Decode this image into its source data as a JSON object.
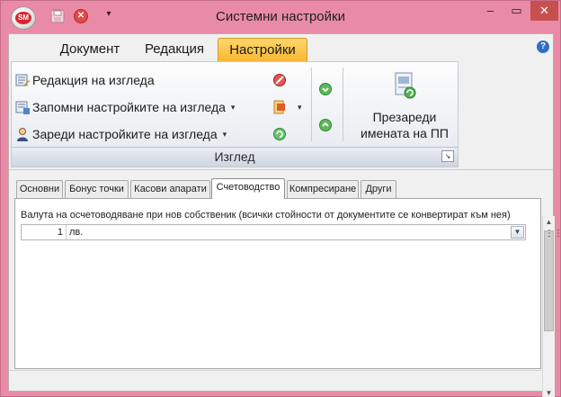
{
  "window": {
    "title": "Системни настройки",
    "app_badge": "SM",
    "minimize": "–",
    "maximize": "▭",
    "close": "✕",
    "quick_access_dropdown": "▾"
  },
  "ribbon": {
    "tabs": [
      {
        "label": "Документ",
        "active": false
      },
      {
        "label": "Редакция",
        "active": false
      },
      {
        "label": "Настройки",
        "active": true
      }
    ],
    "help": "?",
    "group": {
      "caption": "Изглед",
      "items": [
        {
          "label": "Редакция на изгледа",
          "icon": "layout-edit-icon"
        },
        {
          "label": "Запомни настройките на изгледа",
          "icon": "save-layout-icon",
          "has_dropdown": true
        },
        {
          "label": "Зареди настройките на изгледа",
          "icon": "load-layout-icon",
          "has_dropdown": true
        }
      ],
      "small_buttons": [
        "clear-icon",
        "export-icon",
        "refresh-icon",
        "move-down-icon",
        "move-up-icon"
      ],
      "big_button": {
        "line1": "Презареди",
        "line2": "имената на ПП",
        "icon": "reload-names-icon"
      },
      "launcher": "↘"
    },
    "split_arrow": "▾"
  },
  "page_tabs": [
    {
      "label": "Основни",
      "active": false
    },
    {
      "label": "Бонус точки",
      "active": false
    },
    {
      "label": "Касови апарати",
      "active": false
    },
    {
      "label": "Счетоводство",
      "active": true
    },
    {
      "label": "Компресиране",
      "active": false
    },
    {
      "label": "Други",
      "active": false
    }
  ],
  "accounting": {
    "label": "Валута на осчетоводяване при нов собственик (всички стойности от документите се конвертират към нея)",
    "currency_code": "1",
    "currency_name": "лв."
  },
  "scrollbar": {
    "up": "▲",
    "down": "▼",
    "grip": "⋮⋮"
  },
  "colors": {
    "frame": "#e98ba6",
    "active_tab": "#f9b733",
    "close_button": "#c7504f"
  }
}
